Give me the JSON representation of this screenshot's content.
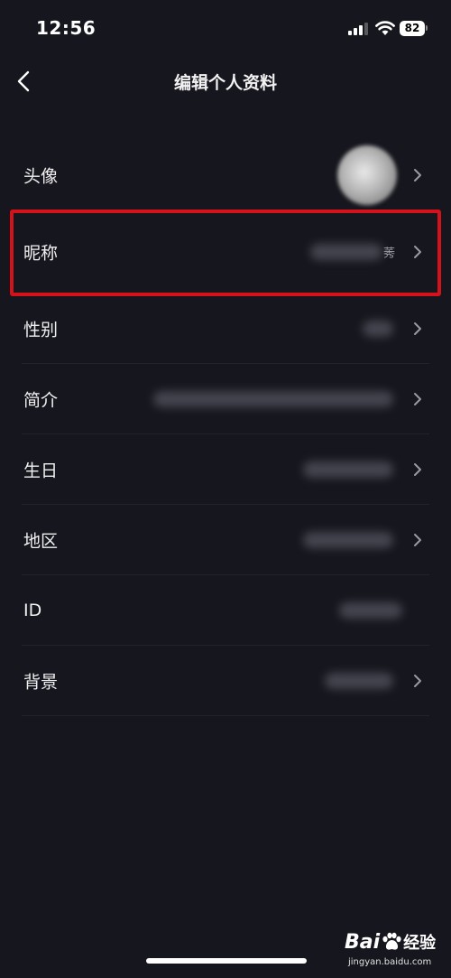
{
  "status_bar": {
    "time": "12:56",
    "battery": "82"
  },
  "nav": {
    "title": "编辑个人资料",
    "back_icon": "chevron-left-icon"
  },
  "rows": [
    {
      "key": "avatar",
      "label": "头像"
    },
    {
      "key": "nickname",
      "label": "昵称",
      "value_suffix": "莠"
    },
    {
      "key": "gender",
      "label": "性别"
    },
    {
      "key": "bio",
      "label": "简介"
    },
    {
      "key": "birthday",
      "label": "生日"
    },
    {
      "key": "region",
      "label": "地区"
    },
    {
      "key": "id",
      "label": "ID"
    },
    {
      "key": "background",
      "label": "背景"
    }
  ],
  "colors": {
    "background": "#16161e",
    "highlight": "#d3121b"
  },
  "watermark": {
    "brand": "Bai",
    "product": "经验",
    "url": "jingyan.baidu.com"
  }
}
